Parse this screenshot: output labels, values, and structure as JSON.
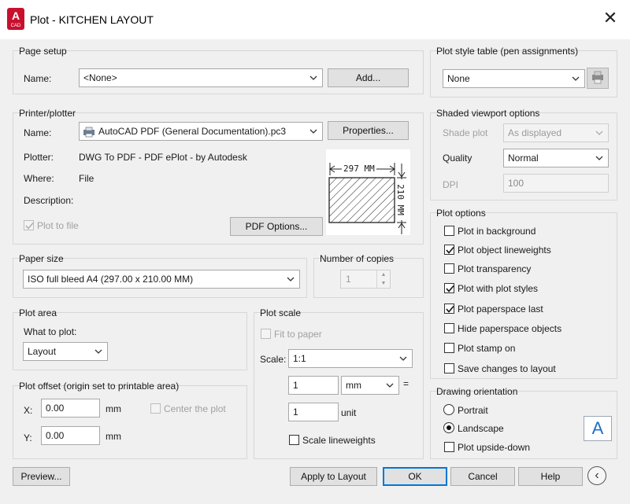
{
  "window": {
    "title": "Plot - KITCHEN LAYOUT",
    "app_icon_letter": "A",
    "app_icon_sub": "CAD",
    "close_glyph": "✕"
  },
  "page_setup": {
    "group_label": "Page setup",
    "name_label": "Name:",
    "name_value": "<None>",
    "add_button": "Add..."
  },
  "printer": {
    "group_label": "Printer/plotter",
    "name_label": "Name:",
    "name_value": "AutoCAD PDF (General Documentation).pc3",
    "properties_button": "Properties...",
    "plotter_label": "Plotter:",
    "plotter_value": "DWG To PDF - PDF ePlot - by Autodesk",
    "where_label": "Where:",
    "where_value": "File",
    "description_label": "Description:",
    "plot_to_file_label": "Plot to file",
    "plot_to_file_checked": true,
    "pdf_options_button": "PDF Options...",
    "preview_width_label": "297 MM",
    "preview_height_label": "210 MM"
  },
  "paper_size": {
    "group_label": "Paper size",
    "value": "ISO full bleed A4 (297.00 x 210.00 MM)"
  },
  "copies": {
    "group_label": "Number of copies",
    "value": "1"
  },
  "plot_area": {
    "group_label": "Plot area",
    "what_label": "What to plot:",
    "what_value": "Layout"
  },
  "plot_offset": {
    "group_label": "Plot offset (origin set to printable area)",
    "x_label": "X:",
    "x_value": "0.00",
    "x_unit": "mm",
    "y_label": "Y:",
    "y_value": "0.00",
    "y_unit": "mm",
    "center_label": "Center the plot"
  },
  "plot_scale": {
    "group_label": "Plot scale",
    "fit_label": "Fit to paper",
    "scale_label": "Scale:",
    "scale_value": "1:1",
    "mm_value": "1",
    "mm_unit": "mm",
    "equals": "=",
    "unit_value": "1",
    "unit_label": "unit",
    "lineweights_label": "Scale lineweights"
  },
  "plot_style": {
    "group_label": "Plot style table (pen assignments)",
    "value": "None"
  },
  "shaded": {
    "group_label": "Shaded viewport options",
    "shade_label": "Shade plot",
    "shade_value": "As displayed",
    "quality_label": "Quality",
    "quality_value": "Normal",
    "dpi_label": "DPI",
    "dpi_value": "100"
  },
  "plot_options": {
    "group_label": "Plot options",
    "items": [
      {
        "label": "Plot in background",
        "checked": false
      },
      {
        "label": "Plot object lineweights",
        "checked": true
      },
      {
        "label": "Plot transparency",
        "checked": false
      },
      {
        "label": "Plot with plot styles",
        "checked": true
      },
      {
        "label": "Plot paperspace last",
        "checked": true
      },
      {
        "label": "Hide paperspace objects",
        "checked": false
      },
      {
        "label": "Plot stamp on",
        "checked": false
      },
      {
        "label": "Save changes to layout",
        "checked": false
      }
    ]
  },
  "orientation": {
    "group_label": "Drawing orientation",
    "portrait_label": "Portrait",
    "landscape_label": "Landscape",
    "selected": "Landscape",
    "upside_down_label": "Plot upside-down",
    "icon_letter": "A"
  },
  "footer": {
    "preview_button": "Preview...",
    "apply_button": "Apply to Layout",
    "ok_button": "OK",
    "cancel_button": "Cancel",
    "help_button": "Help",
    "more_glyph": "‹"
  }
}
